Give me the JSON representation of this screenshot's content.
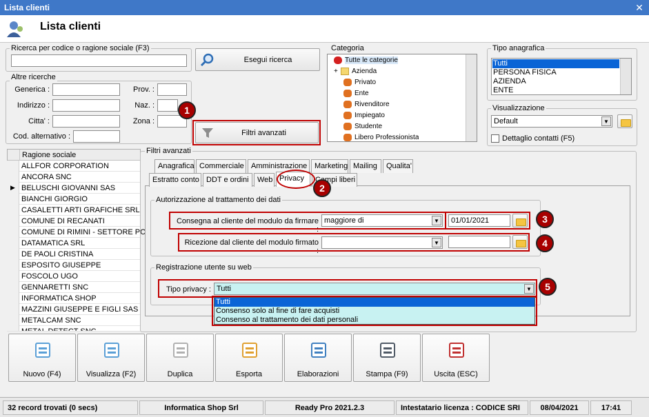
{
  "window": {
    "title": "Lista clienti"
  },
  "header": {
    "title": "Lista clienti"
  },
  "search": {
    "group_label": "Ricerca per codice o ragione sociale (F3)",
    "value": "",
    "button_label": "Esegui ricerca"
  },
  "altre": {
    "group_label": "Altre ricerche",
    "generica_label": "Generica :",
    "indirizzo_label": "Indirizzo :",
    "citta_label": "Citta' :",
    "cod_alt_label": "Cod. alternativo :",
    "prov_label": "Prov. :",
    "naz_label": "Naz. :",
    "zona_label": "Zona :"
  },
  "filtri_button": "Filtri avanzati",
  "categoria": {
    "label": "Categoria",
    "items": [
      "Tutte le categorie",
      "Azienda",
      "Privato",
      "Ente",
      "Rivenditore",
      "Impiegato",
      "Studente",
      "Libero Professionista"
    ]
  },
  "tipo_anagrafica": {
    "label": "Tipo anagrafica",
    "items": [
      "Tutti",
      "PERSONA FISICA",
      "AZIENDA",
      "ENTE"
    ]
  },
  "visualizzazione": {
    "label": "Visualizzazione",
    "value": "Default",
    "dettaglio_label": "Dettaglio contatti (F5)"
  },
  "grid": {
    "header": "Ragione sociale",
    "rows": [
      "ALLFOR CORPORATION",
      "ANCORA SNC",
      "BELUSCHI GIOVANNI SAS",
      "BIANCHI GIORGIO",
      "CASALETTI ARTI GRAFICHE SRL",
      "COMUNE DI RECANATI",
      "COMUNE DI RIMINI - SETTORE POL",
      "DATAMATICA SRL",
      "DE PAOLI CRISTINA",
      "ESPOSITO GIUSEPPE",
      "FOSCOLO UGO",
      "GENNARETTI SNC",
      "INFORMATICA SHOP",
      "MAZZINI GIUSEPPE E FIGLI SAS",
      "METALCAM SNC",
      "METAL DETECT SNC"
    ]
  },
  "filtri_panel": {
    "label": "Filtri avanzati",
    "tabs_row1": [
      "Anagrafica",
      "Commerciale",
      "Amministrazione",
      "Marketing",
      "Mailing",
      "Qualita'"
    ],
    "tabs_row2": [
      "Estratto conto",
      "DDT e ordini",
      "Web",
      "Privacy",
      "Campi liberi"
    ],
    "autorizzazione": {
      "label": "Autorizzazione al trattamento dei dati",
      "consegna_label": "Consegna al cliente del modulo da firmare :",
      "consegna_value": "maggiore di",
      "consegna_date": "01/01/2021",
      "ricezione_label": "Ricezione dal cliente del modulo firmato :",
      "ricezione_value": "",
      "ricezione_date": ""
    },
    "registrazione": {
      "label": "Registrazione utente su web",
      "tipo_label": "Tipo privacy :",
      "tipo_value": "Tutti",
      "options": [
        "Tutti",
        "Consenso solo al fine di fare acquisti",
        "Consenso al trattamento dei dati personali"
      ]
    }
  },
  "badges": [
    "1",
    "2",
    "3",
    "4",
    "5"
  ],
  "toolbar": [
    "Nuovo (F4)",
    "Visualizza (F2)",
    "Duplica",
    "Esporta",
    "Elaborazioni",
    "Stampa (F9)",
    "Uscita (ESC)"
  ],
  "status": {
    "records": "32 record trovati (0 secs)",
    "company": "Informatica Shop Srl",
    "version": "Ready Pro 2021.2.3",
    "license": "Intestatario licenza : CODICE SRI",
    "date": "08/04/2021",
    "time": "17:41"
  },
  "colors": {
    "title_bar": "#3f78c8",
    "highlight": "#c00000",
    "selection": "#0a64d6",
    "dropdown_bg": "#c8f2f2"
  }
}
